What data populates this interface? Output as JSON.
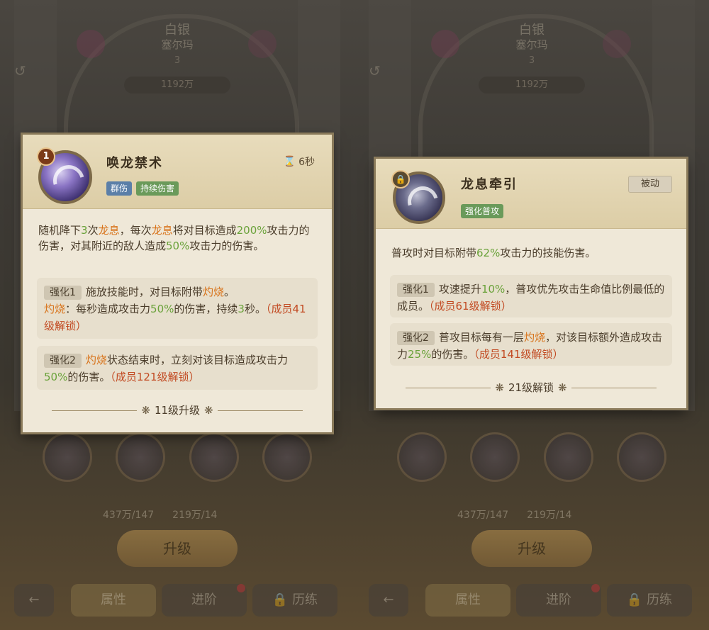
{
  "left": {
    "bg": {
      "name_line1": "白银",
      "name_line2": "塞尔玛",
      "level": "3",
      "power": "1192万",
      "resource1": "437万/147",
      "resource2": "219万/14",
      "upgrade_label": "升级",
      "nav": [
        "属性",
        "进阶",
        "历练"
      ]
    },
    "card": {
      "badge": "1",
      "name": "唤龙禁术",
      "tags": [
        "群伤",
        "持续伤害"
      ],
      "cooldown": "6秒",
      "desc": [
        {
          "t": "随机降下",
          "c": ""
        },
        {
          "t": "3",
          "c": "hl-g"
        },
        {
          "t": "次",
          "c": ""
        },
        {
          "t": "龙息",
          "c": "hl-o"
        },
        {
          "t": "，每次",
          "c": ""
        },
        {
          "t": "龙息",
          "c": "hl-o"
        },
        {
          "t": "将对目标造成",
          "c": ""
        },
        {
          "t": "200%",
          "c": "hl-g"
        },
        {
          "t": "攻击力的伤害，对其附近的敌人造成",
          "c": ""
        },
        {
          "t": "50%",
          "c": "hl-g"
        },
        {
          "t": "攻击力的伤害。",
          "c": ""
        }
      ],
      "enh1": {
        "chip": "强化1",
        "parts": [
          {
            "t": "施放技能时，对目标附带",
            "c": ""
          },
          {
            "t": "灼烧",
            "c": "hl-o"
          },
          {
            "t": "。",
            "c": ""
          },
          {
            "t": "灼烧",
            "c": "hl-o",
            "br": true
          },
          {
            "t": "：每秒造成攻击力",
            "c": ""
          },
          {
            "t": "50%",
            "c": "hl-g"
          },
          {
            "t": "的伤害，持续",
            "c": ""
          },
          {
            "t": "3",
            "c": "hl-g"
          },
          {
            "t": "秒。",
            "c": ""
          },
          {
            "t": "（成员41级解锁）",
            "c": "hl-r"
          }
        ]
      },
      "enh2": {
        "chip": "强化2",
        "parts": [
          {
            "t": "灼烧",
            "c": "hl-o"
          },
          {
            "t": "状态结束时，立刻对该目标造成攻击力",
            "c": ""
          },
          {
            "t": "50%",
            "c": "hl-g"
          },
          {
            "t": "的伤害。",
            "c": ""
          },
          {
            "t": "（成员121级解锁）",
            "c": "hl-r"
          }
        ]
      },
      "footer": "11级升级"
    }
  },
  "right": {
    "bg": {
      "name_line1": "白银",
      "name_line2": "塞尔玛",
      "level": "3",
      "power": "1192万",
      "resource1": "437万/147",
      "resource2": "219万/14",
      "upgrade_label": "升级",
      "nav": [
        "属性",
        "进阶",
        "历练"
      ]
    },
    "card": {
      "name": "龙息牵引",
      "tags": [
        "强化普攻"
      ],
      "passive": "被动",
      "desc": [
        {
          "t": "普攻时对目标附带",
          "c": ""
        },
        {
          "t": "62%",
          "c": "hl-g"
        },
        {
          "t": "攻击力的技能伤害。",
          "c": ""
        }
      ],
      "enh1": {
        "chip": "强化1",
        "parts": [
          {
            "t": "攻速提升",
            "c": ""
          },
          {
            "t": "10%",
            "c": "hl-g"
          },
          {
            "t": "，普攻优先攻击生命值比例最低的成员。",
            "c": ""
          },
          {
            "t": "（成员61级解锁）",
            "c": "hl-r"
          }
        ]
      },
      "enh2": {
        "chip": "强化2",
        "parts": [
          {
            "t": "普攻目标每有一层",
            "c": ""
          },
          {
            "t": "灼烧",
            "c": "hl-o"
          },
          {
            "t": "，对该目标额外造成攻击力",
            "c": ""
          },
          {
            "t": "25%",
            "c": "hl-g"
          },
          {
            "t": "的伤害。",
            "c": ""
          },
          {
            "t": "（成员141级解锁）",
            "c": "hl-r"
          }
        ]
      },
      "footer": "21级解锁"
    }
  }
}
